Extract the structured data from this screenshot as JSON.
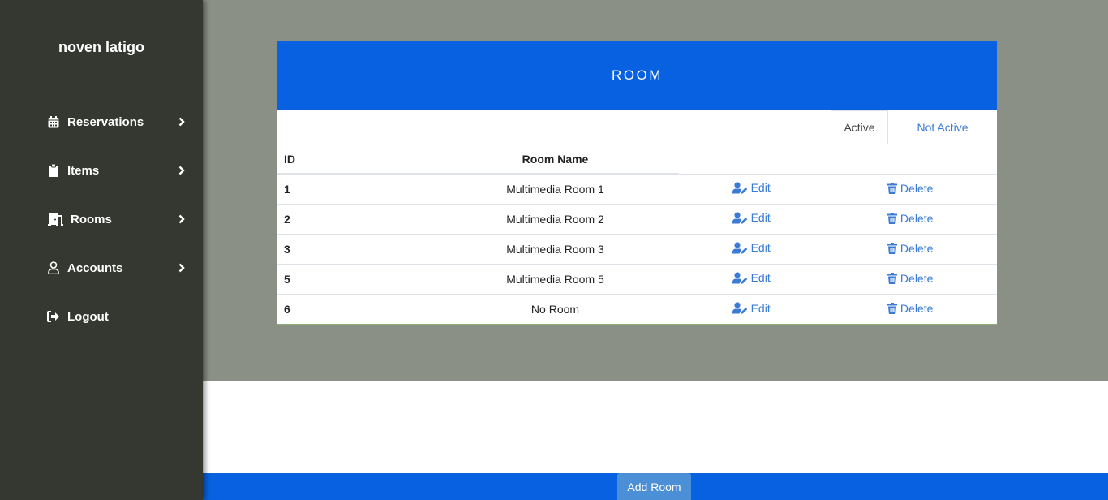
{
  "sidebar": {
    "brand": "noven latigo",
    "items": [
      {
        "label": "Reservations",
        "icon": "calendar-icon",
        "has_chevron": true
      },
      {
        "label": "Items",
        "icon": "clipboard-icon",
        "has_chevron": true
      },
      {
        "label": "Rooms",
        "icon": "door-icon",
        "has_chevron": true
      },
      {
        "label": "Accounts",
        "icon": "user-icon",
        "has_chevron": true
      },
      {
        "label": "Logout",
        "icon": "logout-icon",
        "has_chevron": false
      }
    ]
  },
  "card": {
    "title": "ROOM",
    "tabs": [
      {
        "label": "Active",
        "selected": true
      },
      {
        "label": "Not Active",
        "selected": false
      }
    ],
    "table": {
      "headers": {
        "id": "ID",
        "name": "Room Name"
      },
      "edit_label": "Edit",
      "delete_label": "Delete",
      "rows": [
        {
          "id": "1",
          "name": "Multimedia Room 1"
        },
        {
          "id": "2",
          "name": "Multimedia Room 2"
        },
        {
          "id": "3",
          "name": "Multimedia Room 3"
        },
        {
          "id": "5",
          "name": "Multimedia Room 5"
        },
        {
          "id": "6",
          "name": "No Room"
        }
      ]
    }
  },
  "footer": {
    "add_label": "Add Room"
  },
  "colors": {
    "sidebar_bg": "#353830",
    "content_bg": "#8a9085",
    "accent_blue": "#0761e0",
    "link_blue": "#3a7bd5",
    "button_blue": "#4b8fd6"
  }
}
